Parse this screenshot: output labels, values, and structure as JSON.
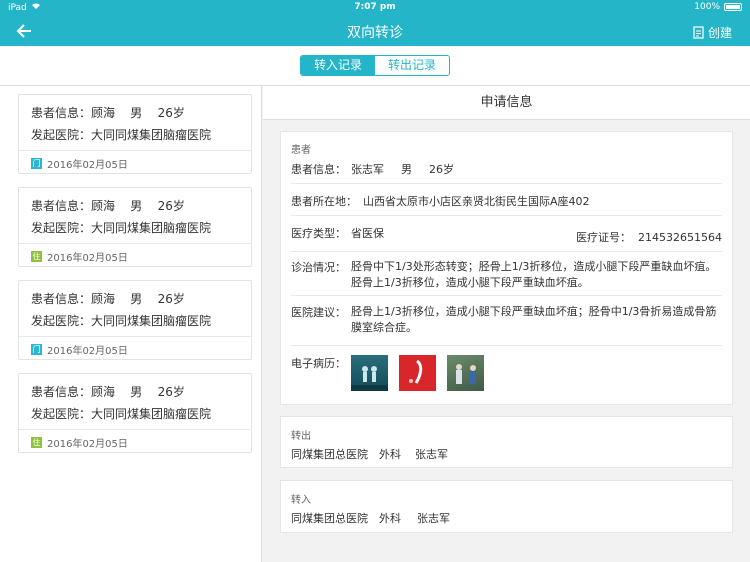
{
  "status_bar": {
    "device": "iPad",
    "time": "7:07 pm",
    "battery": "100%"
  },
  "nav": {
    "title": "双向转诊",
    "create_label": "创建"
  },
  "segments": {
    "in": "转入记录",
    "out": "转出记录"
  },
  "records": [
    {
      "patient_label": "患者信息：",
      "patient_name": "顾海",
      "gender": "男",
      "age": "26岁",
      "hospital_label": "发起医院：",
      "hospital": "大同同煤集团脑瘤医院",
      "badge": "门",
      "badge_color": "#2bb6d2",
      "date": "2016年02月05日"
    },
    {
      "patient_label": "患者信息：",
      "patient_name": "顾海",
      "gender": "男",
      "age": "26岁",
      "hospital_label": "发起医院：",
      "hospital": "大同同煤集团脑瘤医院",
      "badge": "住",
      "badge_color": "#8dc23e",
      "date": "2016年02月05日"
    },
    {
      "patient_label": "患者信息：",
      "patient_name": "顾海",
      "gender": "男",
      "age": "26岁",
      "hospital_label": "发起医院：",
      "hospital": "大同同煤集团脑瘤医院",
      "badge": "门",
      "badge_color": "#2bb6d2",
      "date": "2016年02月05日"
    },
    {
      "patient_label": "患者信息：",
      "patient_name": "顾海",
      "gender": "男",
      "age": "26岁",
      "hospital_label": "发起医院：",
      "hospital": "大同同煤集团脑瘤医院",
      "badge": "住",
      "badge_color": "#8dc23e",
      "date": "2016年02月05日"
    }
  ],
  "detail": {
    "header": "申请信息",
    "patient_section": "患者",
    "patient_label": "患者信息：",
    "patient_name": "张志军",
    "patient_gender": "男",
    "patient_age": "26岁",
    "address_label": "患者所在地：",
    "address": "山西省太原市小店区亲贤北街民生国际A座402",
    "insurance_type_label": "医疗类型：",
    "insurance_type": "省医保",
    "insurance_no_label": "医疗证号：",
    "insurance_no": "214532651564",
    "diagnosis_label": "诊治情况：",
    "diagnosis": "胫骨中下1/3处形态转变；胫骨上1/3折移位，造成小腿下段严重缺血坏疽。胫骨上1/3折移位，造成小腿下段严重缺血坏疽。",
    "advice_label": "医院建议：",
    "advice": "胫骨上1/3折移位，造成小腿下段严重缺血坏疽；胫骨中1/3骨折易造成骨筋膜室综合症。",
    "emr_label": "电子病历：",
    "out_section": "转出",
    "out_hospital": "同煤集团总医院",
    "out_dept": "外科",
    "out_doctor": "张志军",
    "in_section": "转入",
    "in_hospital": "同煤集团总医院",
    "in_dept": "外科",
    "in_doctor": "张志军"
  },
  "colors": {
    "accent": "#25b5c8",
    "badge_blue": "#2bb6d2",
    "badge_green": "#8dc23e"
  }
}
